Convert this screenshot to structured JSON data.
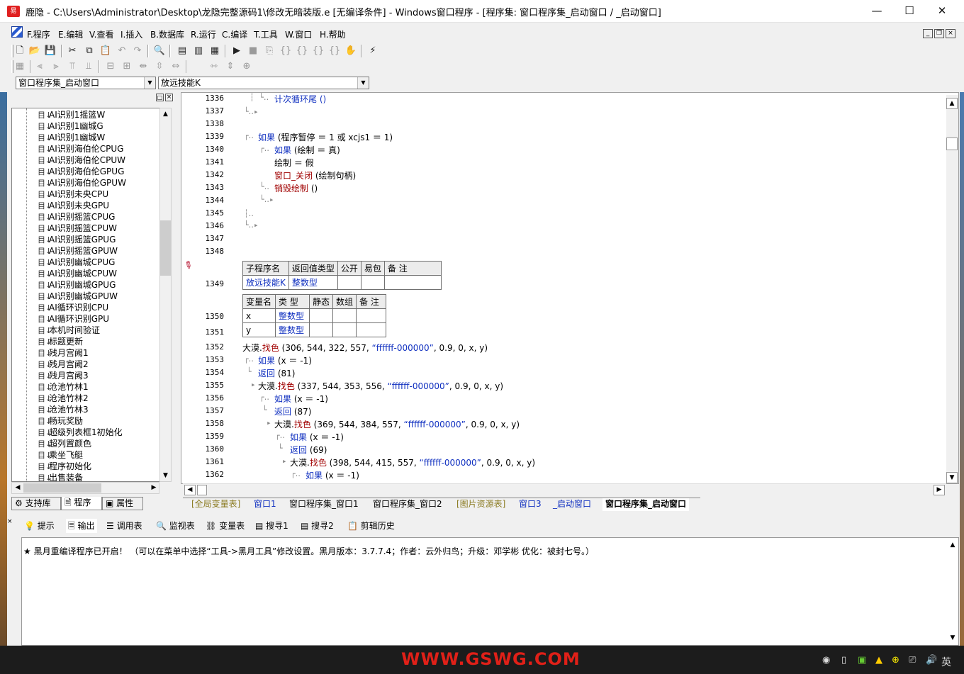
{
  "window": {
    "title": "鹿隐 - C:\\Users\\Administrator\\Desktop\\龙隐完整源码1\\修改无暗装版.e [无编译条件] - Windows窗口程序 - [程序集: 窗口程序集_启动窗口 / _启动窗口]",
    "minimize": "—",
    "maximize": "☐",
    "close": "✕"
  },
  "menu": [
    "F.程序",
    "E.编辑",
    "V.查看",
    "I.插入",
    "B.数据库",
    "R.运行",
    "C.编译",
    "T.工具",
    "W.窗口",
    "H.帮助"
  ],
  "combos": {
    "module": "窗口程序集_启动窗口",
    "sub": "放远技能K"
  },
  "tree": {
    "items": [
      "AI识别1摇篮W",
      "AI识别1幽城G",
      "AI识别1幽城W",
      "AI识别海伯伦CPUG",
      "AI识别海伯伦CPUW",
      "AI识别海伯伦GPUG",
      "AI识别海伯伦GPUW",
      "AI识别未央CPU",
      "AI识别未央GPU",
      "AI识别摇篮CPUG",
      "AI识别摇篮CPUW",
      "AI识别摇篮GPUG",
      "AI识别摇篮GPUW",
      "AI识别幽城CPUG",
      "AI识别幽城CPUW",
      "AI识别幽城GPUG",
      "AI识别幽城GPUW",
      "AI循环识别CPU",
      "AI循环识别GPU",
      "本机时间验证",
      "标题更新",
      "残月宫阙1",
      "残月宫阙2",
      "残月宫阙3",
      "沧池竹林1",
      "沧池竹林2",
      "沧池竹林3",
      "畅玩奖励",
      "超级列表框1初始化",
      "超列置颜色",
      "乘坐飞艇",
      "程序初始化",
      "出售装备"
    ],
    "icon": "目↓"
  },
  "left_tabs": [
    "支持库",
    "程序",
    "属性"
  ],
  "code": {
    "line_numbers": [
      "1336",
      "1337",
      "1338",
      "1339",
      "1340",
      "1341",
      "1342",
      "1343",
      "1344",
      "1345",
      "1346",
      "1347",
      "1348",
      "1349",
      "1350",
      "1351",
      "1352",
      "1353",
      "1354",
      "1355",
      "1356",
      "1357",
      "1358",
      "1359",
      "1360",
      "1361",
      "1362"
    ],
    "l1336": "计次循环尾 ()",
    "l1339": {
      "kw": "如果",
      "rest": " (程序暂停 ＝ 1 或 xcjs1 ＝ 1)"
    },
    "l1340": {
      "kw": "如果",
      "rest": " (绘制 ＝ 真)"
    },
    "l1341": "绘制 ＝ 假",
    "l1342": {
      "fn": "窗口_关闭",
      "rest": " (绘制句柄)"
    },
    "l1343": {
      "fn": "销毁绘制",
      "rest": " ()"
    },
    "sub_table": {
      "headers": [
        "子程序名",
        "返回值类型",
        "公开",
        "易包",
        "备 注"
      ],
      "row": [
        "放远技能K",
        "整数型",
        "",
        "",
        ""
      ]
    },
    "var_table": {
      "headers": [
        "变量名",
        "类 型",
        "静态",
        "数组",
        "备 注"
      ],
      "rows": [
        [
          "x",
          "整数型",
          "",
          "",
          ""
        ],
        [
          "y",
          "整数型",
          "",
          "",
          ""
        ]
      ]
    },
    "l1352": {
      "obj": "大漠",
      "fn": "找色",
      "args": " (306, 544, 322, 557, ",
      "str": "“ffffff-000000”",
      "tail": ", 0.9, 0, x, y)"
    },
    "l1353": {
      "kw": "如果",
      "rest": " (x ＝ -1)"
    },
    "l1354": {
      "kw": "返回",
      "rest": " (81)"
    },
    "l1355": {
      "obj": "大漠",
      "fn": "找色",
      "args": " (337, 544, 353, 556, ",
      "str": "“ffffff-000000”",
      "tail": ", 0.9, 0, x, y)"
    },
    "l1356": {
      "kw": "如果",
      "rest": " (x ＝ -1)"
    },
    "l1357": {
      "kw": "返回",
      "rest": " (87)"
    },
    "l1358": {
      "obj": "大漠",
      "fn": "找色",
      "args": " (369, 544, 384, 557, ",
      "str": "“ffffff-000000”",
      "tail": ", 0.9, 0, x, y)"
    },
    "l1359": {
      "kw": "如果",
      "rest": " (x ＝ -1)"
    },
    "l1360": {
      "kw": "返回",
      "rest": " (69)"
    },
    "l1361": {
      "obj": "大漠",
      "fn": "找色",
      "args": " (398, 544, 415, 557, ",
      "str": "“ffffff-000000”",
      "tail": ", 0.9, 0, x, y)"
    },
    "l1362": {
      "kw": "如果",
      "rest": " (x ＝ -1)"
    }
  },
  "window_tabs": [
    "[全局变量表]",
    "窗口1",
    "窗口程序集_窗口1",
    "窗口程序集_窗口2",
    "[图片资源表]",
    "窗口3",
    "_启动窗口",
    "窗口程序集_启动窗口"
  ],
  "output_tabs": [
    "提示",
    "输出",
    "调用表",
    "监视表",
    "变量表",
    "搜寻1",
    "搜寻2",
    "剪辑历史"
  ],
  "output_text": "★ 黑月重编译程序已开启！  （可以在菜单中选择“工具->黑月工具”修改设置。黑月版本：3.7.7.4；作者：云外归鸟；升级：邓学彬 优化：被封七号。）",
  "watermark": "WWW.GSWG.COM",
  "tray": {
    "lang": "英"
  },
  "colors": {
    "keyword": "#1030c0",
    "function": "#a00000",
    "watermark": "#e02018"
  }
}
